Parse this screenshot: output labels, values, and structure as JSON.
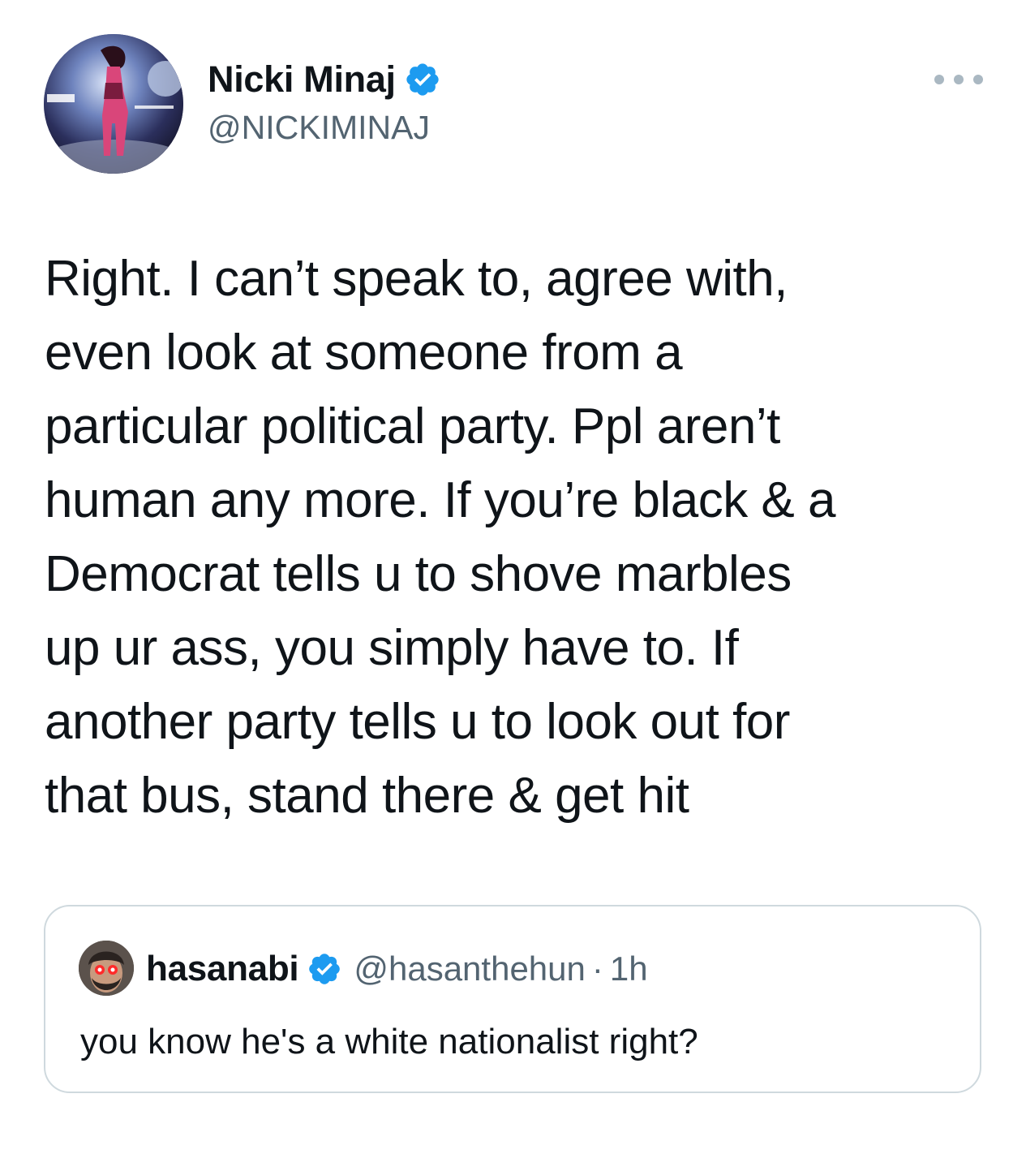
{
  "tweet": {
    "author": {
      "display_name": "Nicki Minaj",
      "handle": "@NICKIMINAJ",
      "verified": true,
      "avatar_icon": "profile-photo-avatar"
    },
    "more_icon": "more-options-icon",
    "text": "Right. I can’t speak to, agree with,\neven look at someone from a\nparticular political party. Ppl aren’t\nhuman any more. If you’re black & a\nDemocrat tells u to shove marbles\nup ur ass, you simply have to. If\nanother party tells u to look out for\nthat bus, stand there & get hit"
  },
  "quoted_tweet": {
    "author": {
      "display_name": "hasanabi",
      "handle": "@hasanthehun",
      "verified": true,
      "avatar_icon": "profile-photo-avatar"
    },
    "separator": "·",
    "time": "1h",
    "text": "you know he's a white nationalist right?"
  },
  "colors": {
    "text_primary": "#0f1419",
    "text_secondary": "#536471",
    "verified_blue": "#1d9bf0",
    "border": "#cfd9de"
  }
}
